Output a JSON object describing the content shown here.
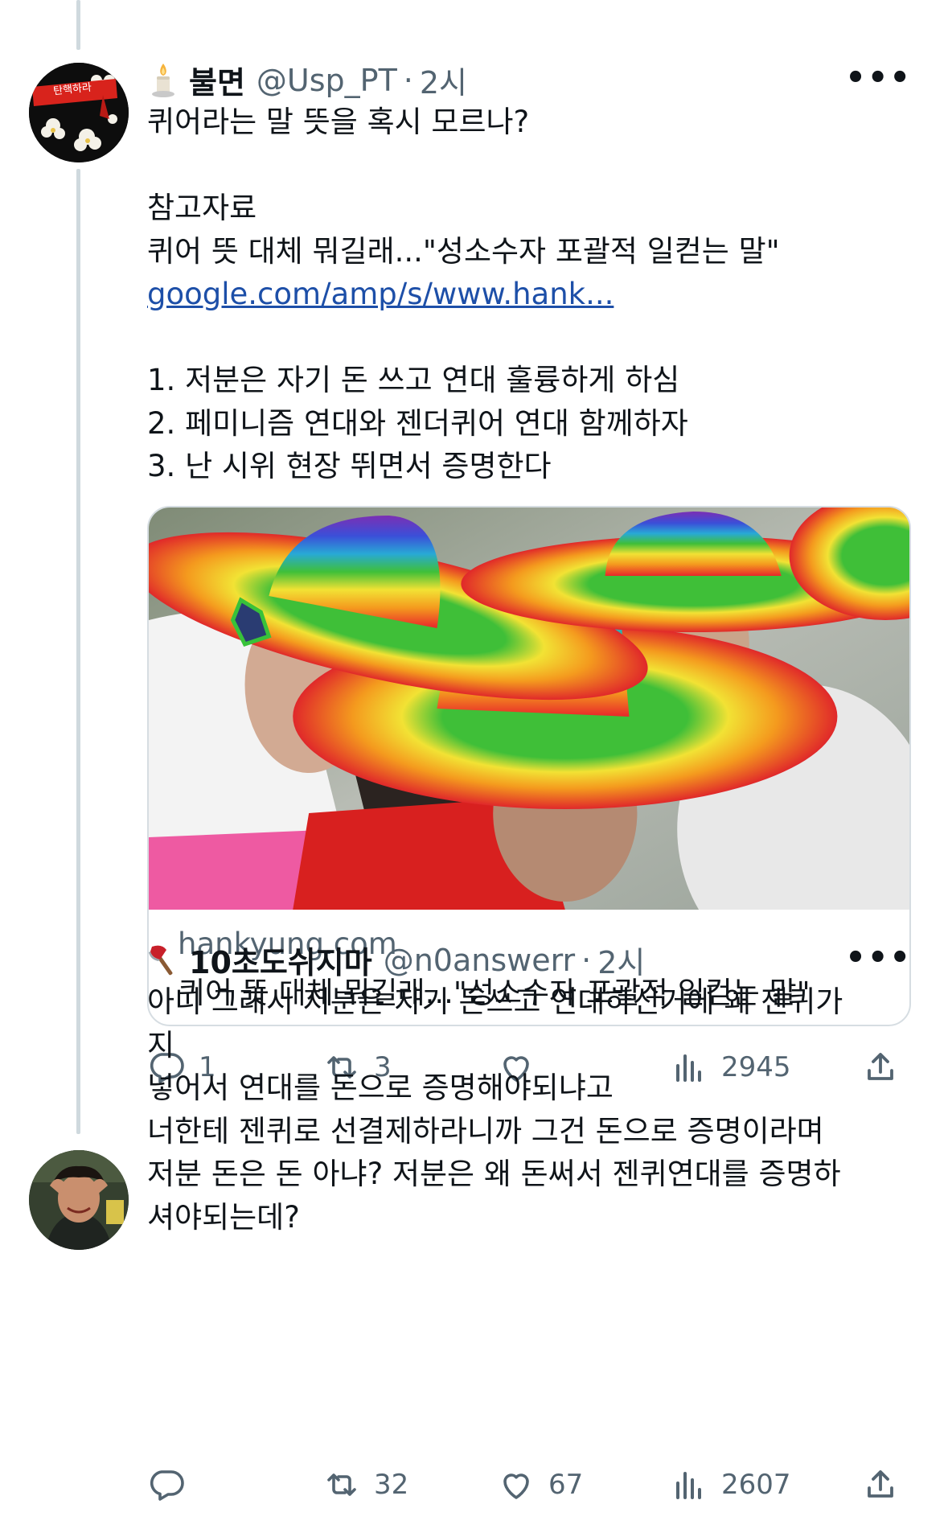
{
  "tweet1": {
    "display_name": "불면",
    "handle": "@Usp_PT",
    "separator": "·",
    "time": "2시",
    "avatar_text": "탄핵하라",
    "text_lines": [
      "퀴어라는 말 뜻을 혹시 모르나?",
      "",
      "참고자료",
      "퀴어 뜻 대체 뭐길래...\"성소수자 포괄적 일컫는 말\"",
      "google.com/amp/s/www.hank...",
      "",
      "1. 저분은 자기 돈 쓰고 연대 훌륭하게 하심",
      "2. 페미니즘 연대와 젠더퀴어 연대 함께하자",
      "3. 난 시위 현장 뛰면서 증명한다"
    ],
    "link_card": {
      "domain": "hankyung.com",
      "title": "퀴어 뜻 대체 뭐길래...\"성소수자 포괄적 일컫는 말\""
    },
    "actions": {
      "replies": "1",
      "retweets": "3",
      "likes": "",
      "views": "2945"
    }
  },
  "tweet2": {
    "display_name": "10초도쉬지마",
    "handle": "@n0answerr",
    "separator": "·",
    "time": "2시",
    "text_lines": [
      "아니 그래서 저분은 자기 돈쓰고 연대하신거에 왜 젠퀴가",
      "지",
      "넣어서 연대를 돈으로 증명해야되냐고",
      "너한테 젠퀴로 선결제하라니까 그건 돈으로 증명이라며",
      "저분 돈은 돈 아냐? 저분은 왜 돈써서 젠퀴연대를 증명하",
      "셔야되는데?"
    ],
    "actions": {
      "replies": "",
      "retweets": "32",
      "likes": "67",
      "views": "2607"
    }
  },
  "more_label": "•••",
  "colors": {
    "text": "#0f1419",
    "secondary": "#536471",
    "link": "#1d4fa8",
    "thread_line": "#cfd9de",
    "border": "#d6dde2"
  },
  "icons": [
    "candle-emoji-icon",
    "axe-emoji-icon",
    "reply-icon",
    "retweet-icon",
    "like-icon",
    "views-icon",
    "share-icon",
    "more-icon"
  ]
}
